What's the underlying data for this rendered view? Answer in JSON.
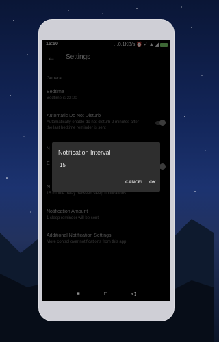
{
  "status_bar": {
    "time": "15:50",
    "indicators": "…0.1KB/s ⏰ ✓ ▲ ◢"
  },
  "app_bar": {
    "title": "Settings",
    "back_icon": "arrow-left-icon"
  },
  "settings": {
    "section_general": "General",
    "bedtime_title": "Bedtime",
    "bedtime_sub": "Bedtime is 22:00",
    "dnd_title": "Automatic Do Not Disturb",
    "dnd_sub": "Automatically enable do not disturb 2 minutes after the last bedtime reminder is sent",
    "hidden_section": "N",
    "hidden_item": "E",
    "hidden_item2": "N",
    "interval_sub": "15 minute delay between sleep notifications",
    "amount_title": "Notification Amount",
    "amount_sub": "1 sleep reminder will be sent",
    "additional_title": "Additional Notification Settings",
    "additional_sub": "More control over notifications from this app"
  },
  "dialog": {
    "title": "Notification Interval",
    "value": "15",
    "cancel": "CANCEL",
    "ok": "OK"
  },
  "nav": {
    "menu": "≡",
    "home": "□",
    "back": "◁"
  }
}
